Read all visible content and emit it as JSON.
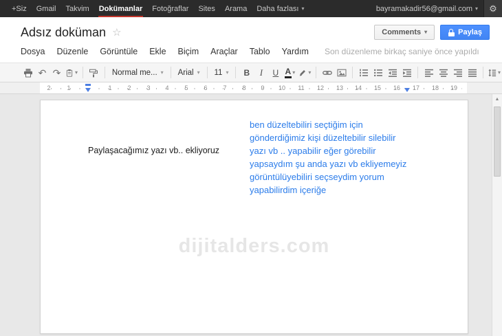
{
  "icons": {
    "dropdown": "▾",
    "gear": "⚙",
    "star": "☆",
    "undo": "↶",
    "redo": "↷",
    "scroll_up": "▲"
  },
  "topbar": {
    "items": [
      "+Siz",
      "Gmail",
      "Takvim",
      "Dokümanlar",
      "Fotoğraflar",
      "Sites",
      "Arama"
    ],
    "more_label": "Daha fazlası",
    "account_email": "bayramakadir56@gmail.com"
  },
  "header": {
    "title": "Adsız doküman",
    "comments_label": "Comments",
    "share_label": "Paylaş"
  },
  "menubar": {
    "items": [
      "Dosya",
      "Düzenle",
      "Görüntüle",
      "Ekle",
      "Biçim",
      "Araçlar",
      "Tablo",
      "Yardım"
    ],
    "status": "Son düzenleme birkaç saniye önce yapıldı"
  },
  "toolbar": {
    "style_value": "Normal me...",
    "font_value": "Arial",
    "size_value": "11",
    "bold_label": "B",
    "italic_label": "I",
    "underline_label": "U",
    "text_color_label": "A"
  },
  "ruler": {
    "numbers": [
      "2",
      "1",
      "1",
      "2",
      "3",
      "4",
      "5",
      "6",
      "7",
      "8",
      "9",
      "10",
      "11",
      "12",
      "13",
      "14",
      "15",
      "16",
      "17",
      "18",
      "19"
    ]
  },
  "page": {
    "paragraph": "Paylaşacağımız yazı vb..  ekliyoruz",
    "comment_text": "ben düzeltebiliri seçtiğim için\ngönderdiğimiz kişi düzeltebilir silebilir\nyazı vb ..  yapabilir eğer görebilir\nyapsaydım şu anda yazı vb ekliyemeyiz\ngörüntülüyebiliri seçseydim yorum\nyapabilirdim içeriğe",
    "text_color": "#2b7cea",
    "watermark": "dijitalders.com"
  }
}
